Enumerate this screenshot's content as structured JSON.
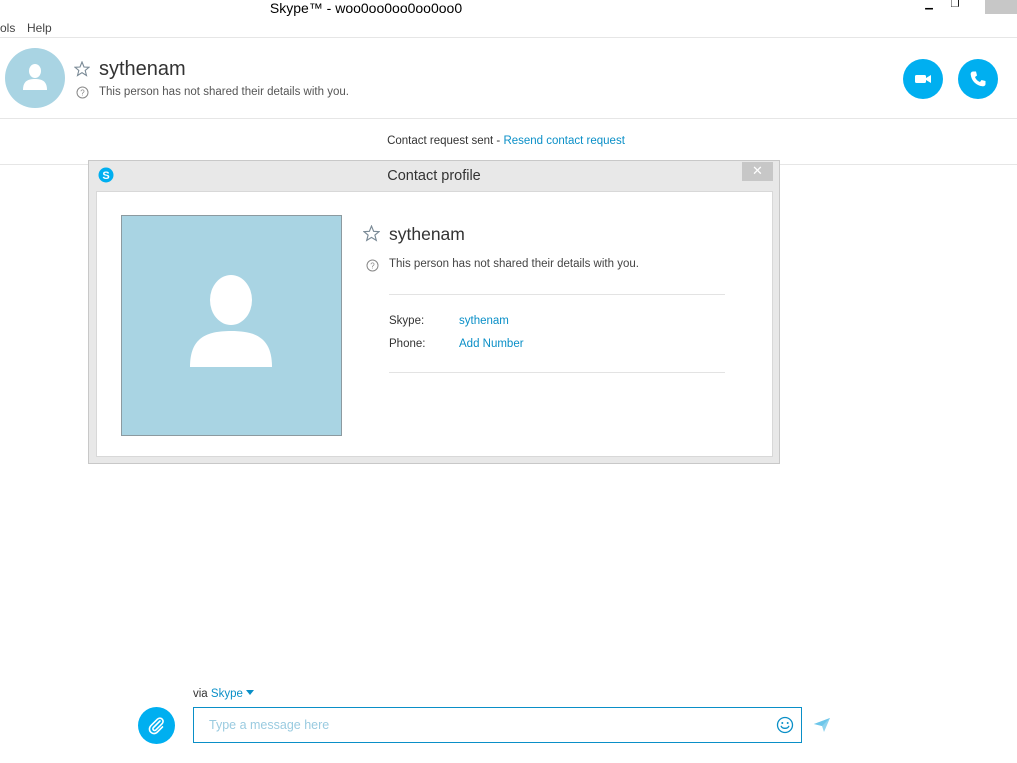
{
  "window": {
    "title": "Skype™ - woo0oo0oo0oo0oo0",
    "minimize_glyph": "▁",
    "restore_glyph": "❐",
    "close_glyph": ""
  },
  "menu": {
    "items": [
      {
        "label": "ols"
      },
      {
        "label": "Help"
      }
    ]
  },
  "header": {
    "name": "sythenam",
    "subtitle": "This person has not shared their details with you.",
    "icons": [
      "avatar-icon",
      "star-icon",
      "help-icon",
      "video-call-icon",
      "phone-call-icon"
    ]
  },
  "request_bar": {
    "status": "Contact request sent",
    "separator": " - ",
    "link": "Resend contact request"
  },
  "dialog": {
    "title": "Contact profile",
    "close_glyph": "✕",
    "name": "sythenam",
    "subtitle": "This person has not shared their details with you.",
    "fields": [
      {
        "label": "Skype:",
        "value": "sythenam"
      },
      {
        "label": "Phone:",
        "value": "Add Number"
      }
    ]
  },
  "composer": {
    "via_prefix": "via ",
    "service": "Skype",
    "placeholder": "Type a message here",
    "value": ""
  },
  "colors": {
    "accent": "#00aff0",
    "link": "#0a8fc7",
    "avatar_bg": "#a9d4e3"
  }
}
